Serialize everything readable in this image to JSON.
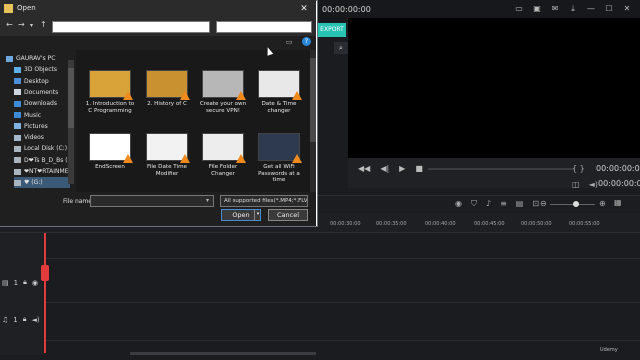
{
  "editor": {
    "top_timecode": "00:00:00:00",
    "export_label": "EXPORT",
    "player_time_1": "00:00:00:00",
    "player_time_2": "00:00:00:00",
    "ruler_ticks": [
      "00:00:30:00",
      "00:00:35:00",
      "00:00:40:00",
      "00:00:45:00",
      "00:00:50:00",
      "00:00:55:00"
    ],
    "tracks": [
      {
        "index": "1",
        "type": "video"
      },
      {
        "index": "1",
        "type": "audio"
      }
    ],
    "watermark": "Udemy"
  },
  "dialog": {
    "title": "Open",
    "address_value": "",
    "search_placeholder": "",
    "nav_items": [
      {
        "label": "GAURAV's PC",
        "icon": "pc-icon",
        "color": "#6fa8dc"
      },
      {
        "label": "3D Objects",
        "icon": "cube-icon",
        "color": "#5fb0e8"
      },
      {
        "label": "Desktop",
        "icon": "desktop-icon",
        "color": "#4a90d9"
      },
      {
        "label": "Documents",
        "icon": "documents-icon",
        "color": "#cfd6de"
      },
      {
        "label": "Downloads",
        "icon": "download-icon",
        "color": "#3d8bd6"
      },
      {
        "label": "Music",
        "icon": "music-icon",
        "color": "#3d8bd6"
      },
      {
        "label": "Pictures",
        "icon": "pictures-icon",
        "color": "#7fb2e0"
      },
      {
        "label": "Videos",
        "icon": "videos-icon",
        "color": "#a4b8cc"
      },
      {
        "label": "Local Disk (C:)",
        "icon": "drive-icon",
        "color": "#aab4bf"
      },
      {
        "label": "D❤Ts B_D_Bs (E:)",
        "icon": "drive-icon",
        "color": "#aab4bf"
      },
      {
        "label": "❤NT❤RTAINMEN",
        "icon": "drive-icon",
        "color": "#aab4bf"
      },
      {
        "label": "♥ (G:)",
        "icon": "drive-icon",
        "color": "#aab4bf"
      }
    ],
    "files": [
      {
        "label": "1. Introduction to C Programming",
        "thumb": "#d9a33a"
      },
      {
        "label": "2. History of C",
        "thumb": "#c9912f"
      },
      {
        "label": "Create your own secure VPN!",
        "thumb": "#b7b7b7"
      },
      {
        "label": "Date & Time changer",
        "thumb": "#e8e8e8"
      },
      {
        "label": "EndScreen",
        "thumb": "#ffffff"
      },
      {
        "label": "File Date Time Modifier",
        "thumb": "#f2f2f2"
      },
      {
        "label": "File Folder Changer",
        "thumb": "#ededed"
      },
      {
        "label": "Get all WiFi Passwords at a time",
        "thumb": "#2d3a4f"
      }
    ],
    "file_name_label": "File name:",
    "file_name_value": "",
    "file_type": "All supported files(*.MP4;*.FLV;",
    "open_label": "Open",
    "cancel_label": "Cancel"
  }
}
